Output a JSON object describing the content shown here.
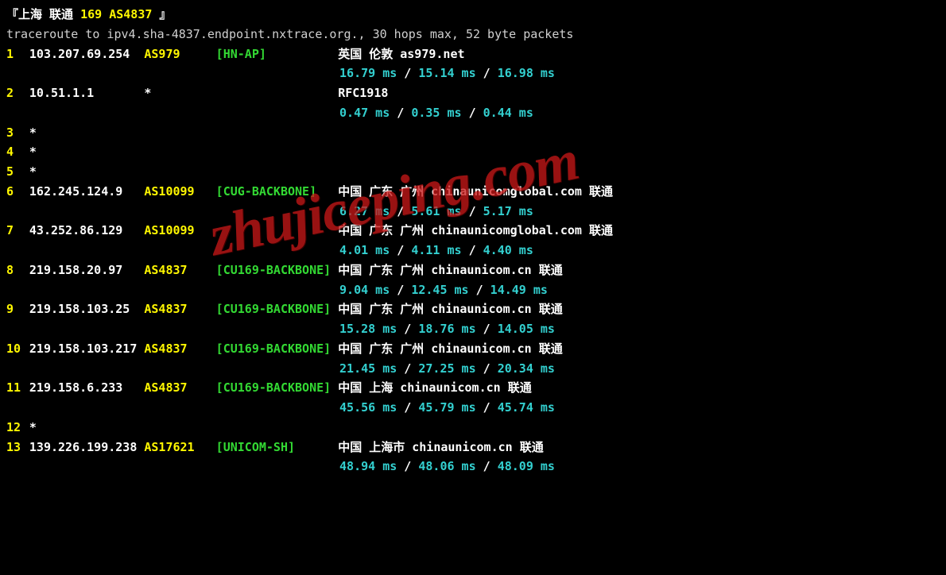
{
  "title": {
    "open": "『",
    "place": "上海 联通",
    "route": " 169 AS4837 ",
    "close": "』"
  },
  "command_line": "traceroute to ipv4.sha-4837.endpoint.nxtrace.org., 30 hops max, 52 byte packets",
  "hops": [
    {
      "n": "1",
      "ip": "103.207.69.254",
      "asn": "AS979",
      "net": "[HN-AP]",
      "info": "英国 伦敦   as979.net",
      "rtt": [
        "16.79 ms",
        "15.14 ms",
        "16.98 ms"
      ]
    },
    {
      "n": "2",
      "ip": "10.51.1.1",
      "asn": "*",
      "net": "",
      "info": "RFC1918",
      "rtt": [
        "0.47 ms",
        "0.35 ms",
        "0.44 ms"
      ]
    },
    {
      "n": "3",
      "ip": "*",
      "asn": "",
      "net": "",
      "info": "",
      "rtt": null
    },
    {
      "n": "4",
      "ip": "*",
      "asn": "",
      "net": "",
      "info": "",
      "rtt": null
    },
    {
      "n": "5",
      "ip": "*",
      "asn": "",
      "net": "",
      "info": "",
      "rtt": null
    },
    {
      "n": "6",
      "ip": "162.245.124.9",
      "asn": "AS10099",
      "net": "[CUG-BACKBONE]",
      "info": "中国 广东 广州   chinaunicomglobal.com  联通",
      "rtt": [
        "6.27 ms",
        "5.61 ms",
        "5.17 ms"
      ]
    },
    {
      "n": "7",
      "ip": "43.252.86.129",
      "asn": "AS10099",
      "net": "",
      "info": "中国 广东 广州   chinaunicomglobal.com  联通",
      "rtt": [
        "4.01 ms",
        "4.11 ms",
        "4.40 ms"
      ]
    },
    {
      "n": "8",
      "ip": "219.158.20.97",
      "asn": "AS4837",
      "net": "[CU169-BACKBONE]",
      "info": "中国 广东 广州   chinaunicom.cn  联通",
      "rtt": [
        "9.04 ms",
        "12.45 ms",
        "14.49 ms"
      ]
    },
    {
      "n": "9",
      "ip": "219.158.103.25",
      "asn": "AS4837",
      "net": "[CU169-BACKBONE]",
      "info": "中国 广东 广州   chinaunicom.cn  联通",
      "rtt": [
        "15.28 ms",
        "18.76 ms",
        "14.05 ms"
      ]
    },
    {
      "n": "10",
      "ip": "219.158.103.217",
      "asn": "AS4837",
      "net": "[CU169-BACKBONE]",
      "info": "中国 广东 广州   chinaunicom.cn  联通",
      "rtt": [
        "21.45 ms",
        "27.25 ms",
        "20.34 ms"
      ]
    },
    {
      "n": "11",
      "ip": "219.158.6.233",
      "asn": "AS4837",
      "net": "[CU169-BACKBONE]",
      "info": "中国 上海   chinaunicom.cn  联通",
      "rtt": [
        "45.56 ms",
        "45.79 ms",
        "45.74 ms"
      ]
    },
    {
      "n": "12",
      "ip": "*",
      "asn": "",
      "net": "",
      "info": "",
      "rtt": null
    },
    {
      "n": "13",
      "ip": "139.226.199.238",
      "asn": "AS17621",
      "net": "[UNICOM-SH]",
      "info": "中国 上海市   chinaunicom.cn  联通",
      "rtt": [
        "48.94 ms",
        "48.06 ms",
        "48.09 ms"
      ]
    }
  ],
  "sep": " / ",
  "watermark": "zhujiceping.com"
}
